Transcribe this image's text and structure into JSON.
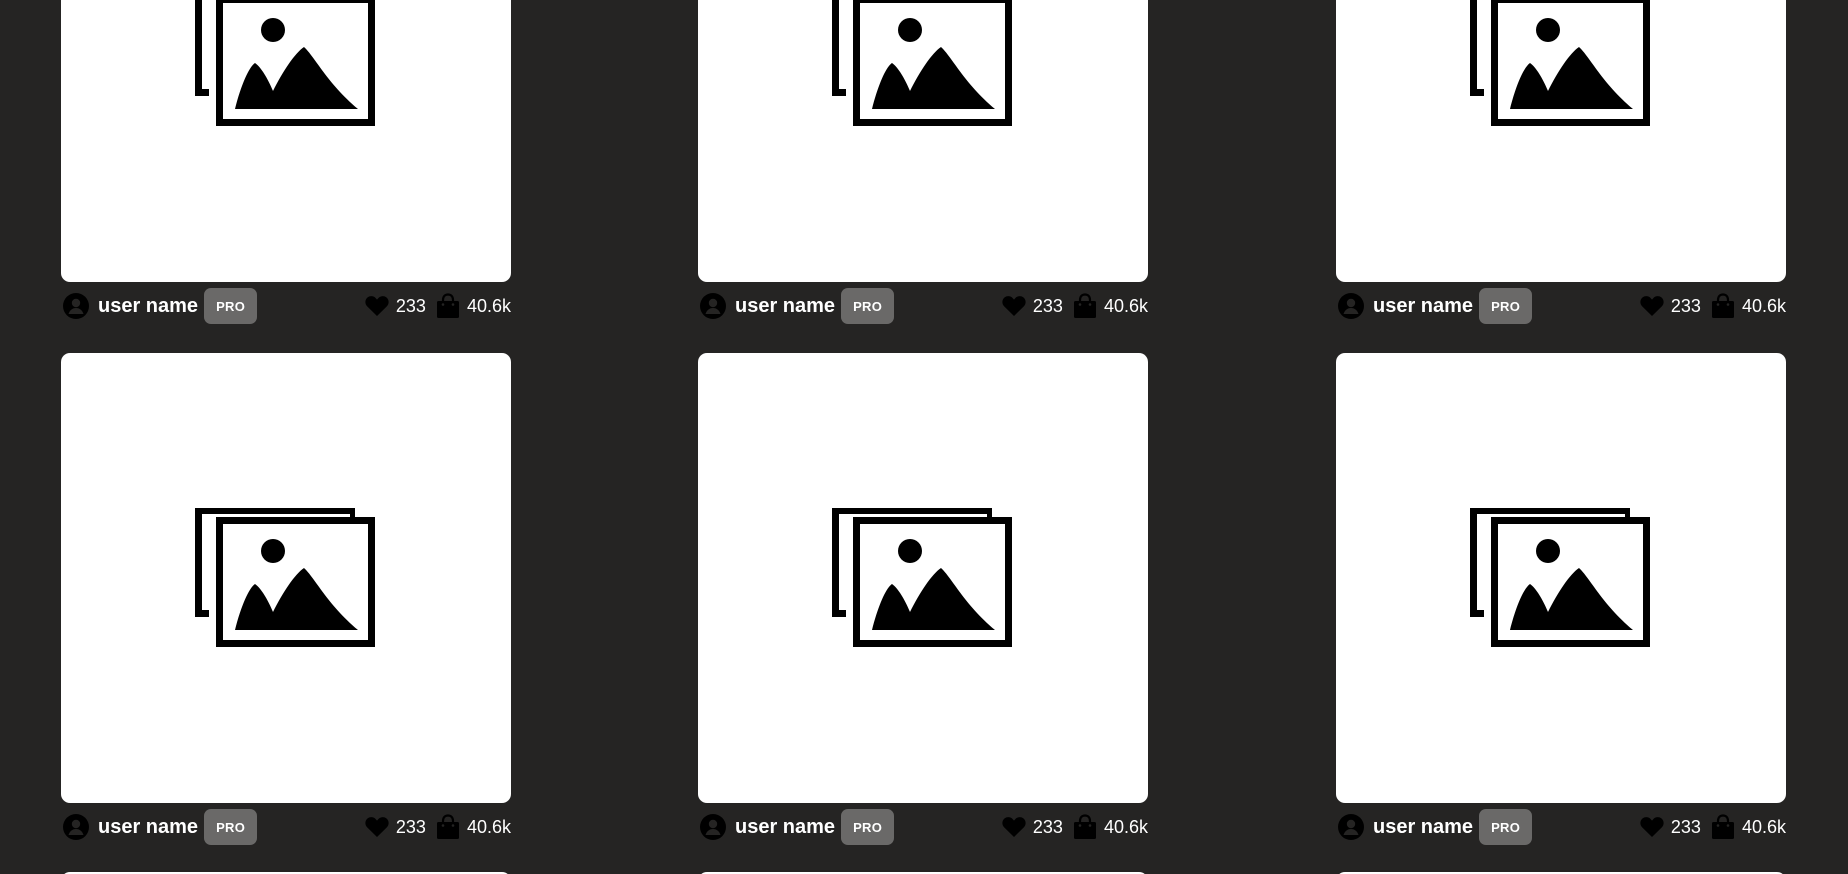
{
  "colors": {
    "background": "#252423",
    "card": "#ffffff",
    "pro_badge": "#6a6968",
    "text": "#ffffff"
  },
  "icons": {
    "thumbnail": "image-placeholder-icon",
    "avatar": "user-avatar-icon",
    "likes": "heart-icon",
    "sales": "shopping-bag-icon"
  },
  "cards": [
    {
      "user": "user name",
      "badge": "PRO",
      "likes": "233",
      "sales": "40.6k"
    },
    {
      "user": "user name",
      "badge": "PRO",
      "likes": "233",
      "sales": "40.6k"
    },
    {
      "user": "user name",
      "badge": "PRO",
      "likes": "233",
      "sales": "40.6k"
    },
    {
      "user": "user name",
      "badge": "PRO",
      "likes": "233",
      "sales": "40.6k"
    },
    {
      "user": "user name",
      "badge": "PRO",
      "likes": "233",
      "sales": "40.6k"
    },
    {
      "user": "user name",
      "badge": "PRO",
      "likes": "233",
      "sales": "40.6k"
    }
  ]
}
